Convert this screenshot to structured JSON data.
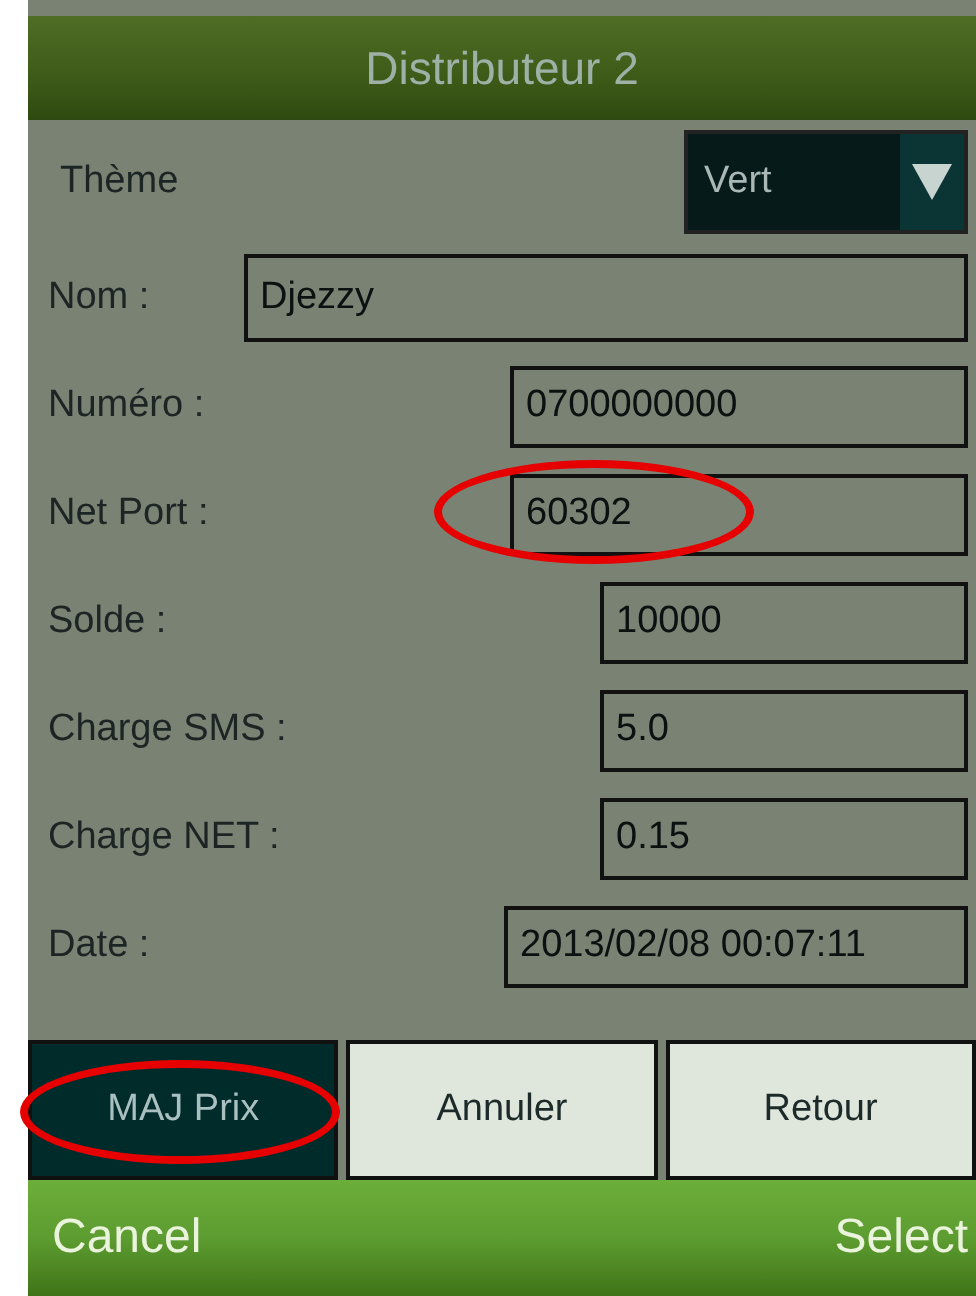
{
  "title_bar": {
    "title": "Distributeur 2"
  },
  "theme": {
    "label": "Thème",
    "value": "Vert"
  },
  "fields": [
    {
      "label": "Nom :",
      "value": "Djezzy",
      "circled": false
    },
    {
      "label": "Numéro :",
      "value": "0700000000",
      "circled": false
    },
    {
      "label": "Net Port :",
      "value": "60302",
      "circled": true
    },
    {
      "label": "Solde :",
      "value": "10000",
      "circled": false
    },
    {
      "label": "Charge SMS :",
      "value": "5.0",
      "circled": false
    },
    {
      "label": "Charge NET :",
      "value": "0.15",
      "circled": false
    },
    {
      "label": "Date :",
      "value": "2013/02/08 00:07:11",
      "circled": false
    }
  ],
  "buttons": [
    {
      "label": "MAJ Prix",
      "selected": true,
      "circled": true
    },
    {
      "label": "Annuler",
      "selected": false,
      "circled": false
    },
    {
      "label": "Retour",
      "selected": false,
      "circled": false
    }
  ],
  "softkeys": {
    "left": "Cancel",
    "right": "Select"
  }
}
